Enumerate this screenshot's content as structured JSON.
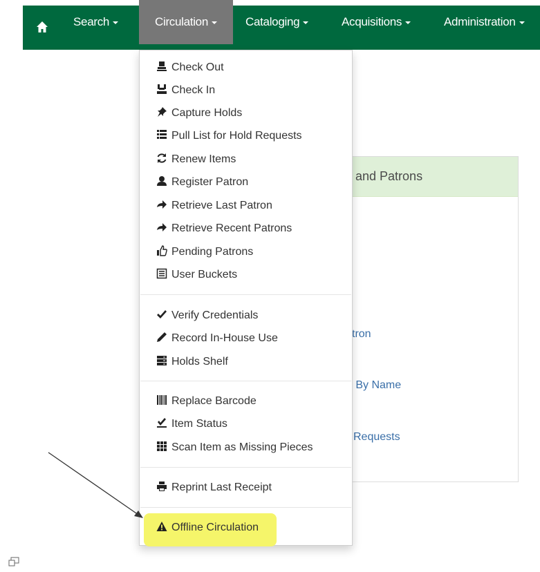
{
  "navbar": {
    "home_icon": "home-icon",
    "items": [
      {
        "label": "Search"
      },
      {
        "label": "Circulation"
      },
      {
        "label": "Cataloging"
      },
      {
        "label": "Acquisitions"
      },
      {
        "label": "Administration"
      }
    ],
    "active": "Circulation",
    "color": "#00693e",
    "active_color": "#777777"
  },
  "panel": {
    "heading": "and Patrons",
    "links": [
      "tron",
      "n By Name",
      "Requests"
    ],
    "heading_color": "#dff0d8",
    "link_color": "#3a6fa8"
  },
  "circulation_menu": {
    "group1": [
      {
        "label": "Check Out",
        "icon": "check-out-icon"
      },
      {
        "label": "Check In",
        "icon": "check-in-icon"
      },
      {
        "label": "Capture Holds",
        "icon": "pushpin-icon"
      },
      {
        "label": "Pull List for Hold Requests",
        "icon": "list-icon"
      },
      {
        "label": "Renew Items",
        "icon": "refresh-icon"
      },
      {
        "label": "Register Patron",
        "icon": "user-icon"
      },
      {
        "label": "Retrieve Last Patron",
        "icon": "arrow-right-icon"
      },
      {
        "label": "Retrieve Recent Patrons",
        "icon": "arrow-right-icon"
      },
      {
        "label": "Pending Patrons",
        "icon": "thumbs-up-icon"
      },
      {
        "label": "User Buckets",
        "icon": "bucket-list-icon"
      }
    ],
    "group2": [
      {
        "label": "Verify Credentials",
        "icon": "checkmark-icon"
      },
      {
        "label": "Record In-House Use",
        "icon": "pencil-icon"
      },
      {
        "label": "Holds Shelf",
        "icon": "shelf-icon"
      }
    ],
    "group3": [
      {
        "label": "Replace Barcode",
        "icon": "barcode-icon"
      },
      {
        "label": "Item Status",
        "icon": "item-status-icon"
      },
      {
        "label": "Scan Item as Missing Pieces",
        "icon": "grid-icon"
      }
    ],
    "group4": [
      {
        "label": "Reprint Last Receipt",
        "icon": "print-icon"
      }
    ],
    "group5": [
      {
        "label": "Offline Circulation",
        "icon": "warning-icon"
      }
    ]
  },
  "annotation": {
    "highlight_color": "#f5f56a",
    "arrow_target": "Offline Circulation"
  }
}
